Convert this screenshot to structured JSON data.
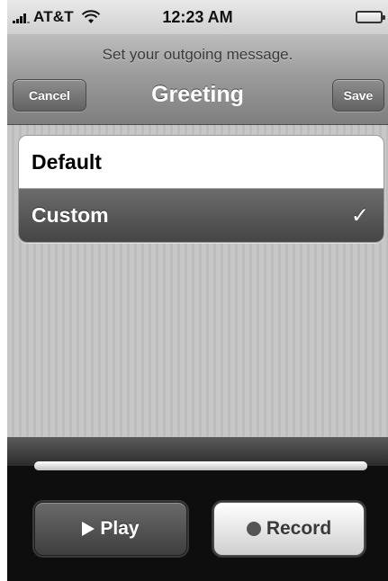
{
  "status_bar": {
    "carrier": "AT&T",
    "time": "12:23 AM",
    "signal_icon": "signal-bars-icon",
    "wifi_icon": "wifi-icon",
    "battery_icon": "battery-icon"
  },
  "header": {
    "prompt": "Set your outgoing message.",
    "title": "Greeting",
    "cancel_label": "Cancel",
    "save_label": "Save"
  },
  "options": {
    "items": [
      {
        "label": "Default",
        "selected": false
      },
      {
        "label": "Custom",
        "selected": true
      }
    ],
    "check_mark": "✓"
  },
  "playback": {
    "progress_fraction": 1.0,
    "play_label": "Play",
    "record_label": "Record",
    "play_icon": "play-icon",
    "record_icon": "record-icon"
  },
  "colors": {
    "selected_row": "#555555",
    "nav_bar": "#9a9a9a",
    "panel": "#0e0e0e"
  }
}
